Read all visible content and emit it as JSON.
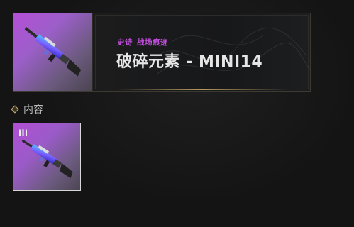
{
  "header": {
    "rarity_label": "史诗",
    "category_label": "战场痕迹",
    "item_title": "破碎元素 - MINI14"
  },
  "content": {
    "section_title": "内容",
    "items": [
      {
        "name": "破碎元素 - MINI14",
        "icon": "rifle-icon"
      }
    ]
  },
  "colors": {
    "rarity_epic": "#c44ee0",
    "accent_gold": "#c9b27a",
    "background": "#141414"
  }
}
